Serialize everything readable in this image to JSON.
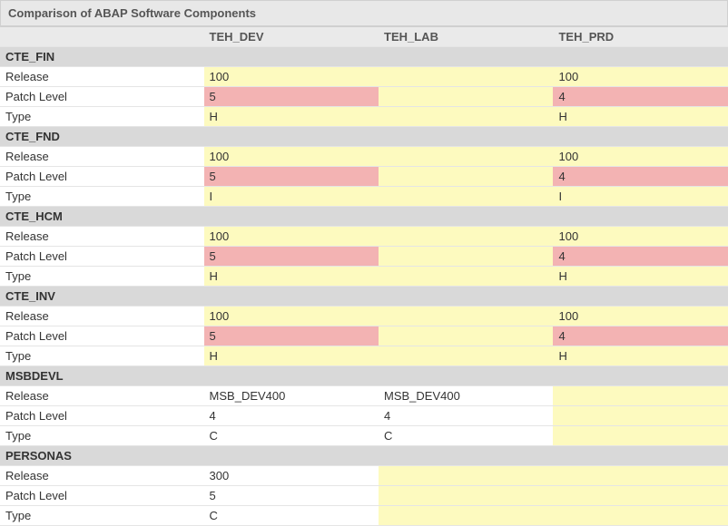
{
  "title": "Comparison of ABAP Software Components",
  "columns": [
    "TEH_DEV",
    "TEH_LAB",
    "TEH_PRD"
  ],
  "row_labels": {
    "release": "Release",
    "patch": "Patch Level",
    "type": "Type"
  },
  "groups": [
    {
      "name": "CTE_FIN",
      "release": {
        "v": [
          "100",
          "",
          "100"
        ],
        "c": [
          "y",
          "y",
          "y"
        ]
      },
      "patch": {
        "v": [
          "5",
          "",
          "4"
        ],
        "c": [
          "r",
          "y",
          "r"
        ]
      },
      "type": {
        "v": [
          "H",
          "",
          "H"
        ],
        "c": [
          "y",
          "y",
          "y"
        ]
      }
    },
    {
      "name": "CTE_FND",
      "release": {
        "v": [
          "100",
          "",
          "100"
        ],
        "c": [
          "y",
          "y",
          "y"
        ]
      },
      "patch": {
        "v": [
          "5",
          "",
          "4"
        ],
        "c": [
          "r",
          "y",
          "r"
        ]
      },
      "type": {
        "v": [
          "I",
          "",
          "I"
        ],
        "c": [
          "y",
          "y",
          "y"
        ]
      }
    },
    {
      "name": "CTE_HCM",
      "release": {
        "v": [
          "100",
          "",
          "100"
        ],
        "c": [
          "y",
          "y",
          "y"
        ]
      },
      "patch": {
        "v": [
          "5",
          "",
          "4"
        ],
        "c": [
          "r",
          "y",
          "r"
        ]
      },
      "type": {
        "v": [
          "H",
          "",
          "H"
        ],
        "c": [
          "y",
          "y",
          "y"
        ]
      }
    },
    {
      "name": "CTE_INV",
      "release": {
        "v": [
          "100",
          "",
          "100"
        ],
        "c": [
          "y",
          "y",
          "y"
        ]
      },
      "patch": {
        "v": [
          "5",
          "",
          "4"
        ],
        "c": [
          "r",
          "y",
          "r"
        ]
      },
      "type": {
        "v": [
          "H",
          "",
          "H"
        ],
        "c": [
          "y",
          "y",
          "y"
        ]
      }
    },
    {
      "name": "MSBDEVL",
      "release": {
        "v": [
          "MSB_DEV400",
          "MSB_DEV400",
          ""
        ],
        "c": [
          "",
          "",
          "y"
        ]
      },
      "patch": {
        "v": [
          "4",
          "4",
          ""
        ],
        "c": [
          "",
          "",
          "y"
        ]
      },
      "type": {
        "v": [
          "C",
          "C",
          ""
        ],
        "c": [
          "",
          "",
          "y"
        ]
      }
    },
    {
      "name": "PERSONAS",
      "release": {
        "v": [
          "300",
          "",
          ""
        ],
        "c": [
          "",
          "y",
          "y"
        ]
      },
      "patch": {
        "v": [
          "5",
          "",
          ""
        ],
        "c": [
          "",
          "y",
          "y"
        ]
      },
      "type": {
        "v": [
          "C",
          "",
          ""
        ],
        "c": [
          "",
          "y",
          "y"
        ]
      }
    }
  ]
}
